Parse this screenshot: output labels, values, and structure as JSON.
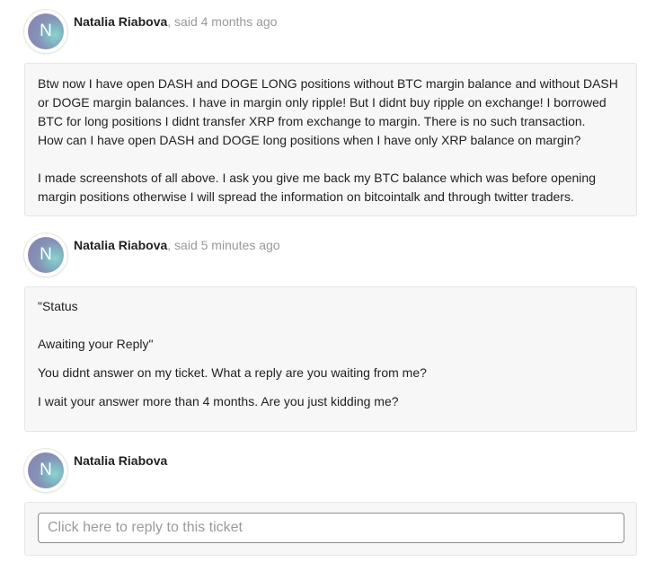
{
  "comments": [
    {
      "avatar_initial": "N",
      "author": "Natalia Riabova",
      "said": ", said 4 months ago",
      "paragraphs": [
        "Btw now I have open DASH and DOGE LONG positions without BTC margin balance and without DASH or DOGE margin balances. I have in margin only ripple! But I didnt buy ripple on exchange! I borrowed BTC for long positions I didnt transfer XRP from exchange to margin. There is no such transaction.",
        "How can I have open DASH and DOGE long positions when I have only XRP balance on margin?",
        "I made screenshots of all above. I ask you give me back my BTC balance which was before opening margin positions otherwise I will spread the information on bitcointalk and through twitter traders."
      ]
    },
    {
      "avatar_initial": "N",
      "author": "Natalia Riabova",
      "said": ", said 5 minutes ago",
      "paragraphs": [
        "\"Status",
        "Awaiting your Reply\"",
        "You didnt answer on my ticket. What a reply are you waiting from me?",
        "I wait your answer more than 4 months. Are you just kidding me?"
      ]
    }
  ],
  "reply": {
    "avatar_initial": "N",
    "author": "Natalia Riabova",
    "placeholder": "Click here to reply to this ticket"
  }
}
